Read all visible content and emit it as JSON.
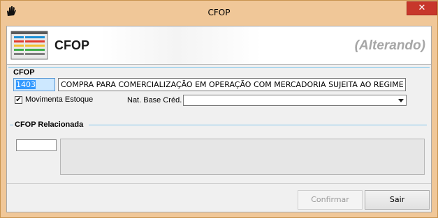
{
  "window": {
    "title": "CFOP",
    "icon": "hand-icon",
    "close_label": "✕"
  },
  "header": {
    "title": "CFOP",
    "mode": "(Alterando)",
    "icon": "table-icon"
  },
  "form": {
    "cfop_label": "CFOP",
    "cfop_code": "1403",
    "cfop_description": "COMPRA PARA COMERCIALIZAÇÃO EM OPERAÇÃO COM MERCADORIA SUJEITA AO REGIME DE",
    "movimenta_estoque_label": "Movimenta Estoque",
    "movimenta_estoque_checked": true,
    "nat_base_cred_label": "Nat. Base Créd.",
    "nat_base_cred_value": ""
  },
  "related": {
    "group_label": "CFOP Relacionada",
    "code_value": ""
  },
  "footer": {
    "confirm_label": "Confirmar",
    "exit_label": "Sair"
  }
}
